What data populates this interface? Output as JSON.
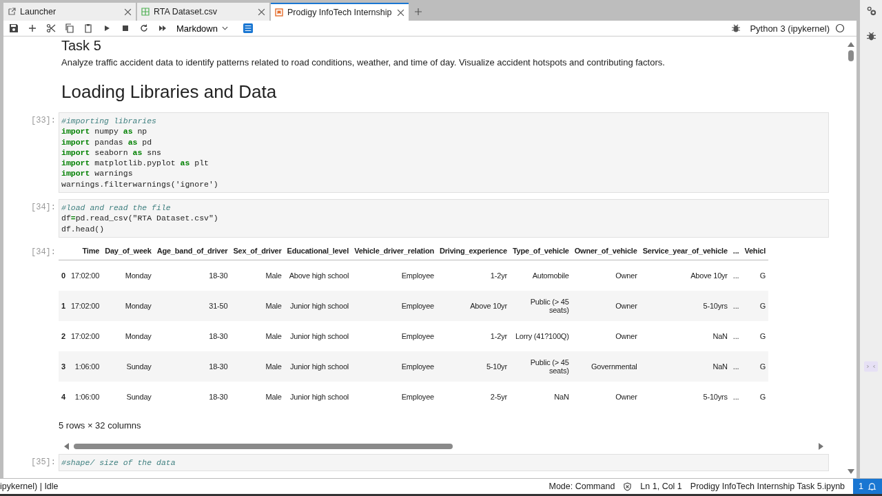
{
  "tabs": [
    {
      "label": "Launcher",
      "selected": false
    },
    {
      "label": "RTA Dataset.csv",
      "selected": false
    },
    {
      "label": "Prodigy InfoTech Internship",
      "selected": true
    }
  ],
  "toolbar": {
    "cell_type": "Markdown",
    "kernel": "Python 3 (ipykernel)"
  },
  "notebook": {
    "heading_cut": "Task 5",
    "description": "Analyze traffic accident data to identify patterns related to road conditions, weather, and time of day. Visualize accident hotspots and contributing factors.",
    "section_heading": "Loading Libraries and Data",
    "cells": [
      {
        "prompt": "[33]:",
        "comment": "#importing libraries",
        "lines": [
          "**import** numpy **as** np",
          "**import** pandas **as** pd",
          "**import** seaborn **as** sns",
          "**import** matplotlib.pyplot **as** plt",
          "**import** warnings",
          "warnings.filterwarnings('ignore')"
        ]
      },
      {
        "prompt": "[34]:",
        "comment": "#load and read the file",
        "lines": [
          "df**=**pd.read_csv(\"RTA Dataset.csv\")",
          "df.head()"
        ]
      }
    ],
    "output": {
      "prompt": "[34]:",
      "columns": [
        "Time",
        "Day_of_week",
        "Age_band_of_driver",
        "Sex_of_driver",
        "Educational_level",
        "Vehicle_driver_relation",
        "Driving_experience",
        "Type_of_vehicle",
        "Owner_of_vehicle",
        "Service_year_of_vehicle",
        "...",
        "Vehicl"
      ],
      "rows": [
        {
          "index": "0",
          "cells": [
            "17:02:00",
            "Monday",
            "18-30",
            "Male",
            "Above high school",
            "Employee",
            "1-2yr",
            "Automobile",
            "Owner",
            "Above 10yr",
            "...",
            "G"
          ]
        },
        {
          "index": "1",
          "cells": [
            "17:02:00",
            "Monday",
            "31-50",
            "Male",
            "Junior high school",
            "Employee",
            "Above 10yr",
            "Public (> 45 seats)",
            "Owner",
            "5-10yrs",
            "...",
            "G"
          ]
        },
        {
          "index": "2",
          "cells": [
            "17:02:00",
            "Monday",
            "18-30",
            "Male",
            "Junior high school",
            "Employee",
            "1-2yr",
            "Lorry (41?100Q)",
            "Owner",
            "NaN",
            "...",
            "G"
          ]
        },
        {
          "index": "3",
          "cells": [
            "1:06:00",
            "Sunday",
            "18-30",
            "Male",
            "Junior high school",
            "Employee",
            "5-10yr",
            "Public (> 45 seats)",
            "Governmental",
            "NaN",
            "...",
            "G"
          ]
        },
        {
          "index": "4",
          "cells": [
            "1:06:00",
            "Sunday",
            "18-30",
            "Male",
            "Junior high school",
            "Employee",
            "2-5yr",
            "NaN",
            "Owner",
            "5-10yrs",
            "...",
            "G"
          ]
        }
      ],
      "footer": "5 rows × 32 columns"
    },
    "next_cell": {
      "prompt": "[35]:",
      "comment": "#shape/ size of the data"
    }
  },
  "status_bar": {
    "left": "ipykernel) | Idle",
    "mode": "Mode: Command",
    "position": "Ln 1, Col 1",
    "file": "Prodigy InfoTech Internship Task 5.ipynb",
    "notifications": "1"
  }
}
